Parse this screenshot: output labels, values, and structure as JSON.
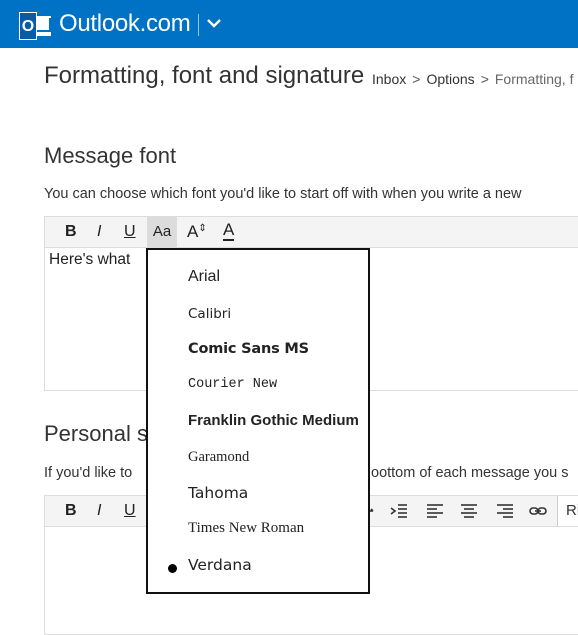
{
  "header": {
    "logo_letter": "O",
    "brand": "Outlook.com",
    "colors": {
      "bar": "#0072c6"
    }
  },
  "page": {
    "title": "Formatting, font and signature",
    "breadcrumb": [
      "Inbox",
      "Options",
      "Formatting, f"
    ]
  },
  "message_font": {
    "heading": "Message font",
    "description": "You can choose which font you'd like to start off with when you write a new",
    "toolbar": {
      "bold": "B",
      "italic": "I",
      "underline": "U",
      "font": "Aa",
      "size": "A",
      "size_arrows": "⇕",
      "color": "A"
    },
    "preview_text": "Here's what"
  },
  "font_menu": {
    "items": [
      {
        "label": "Arial",
        "selected": false
      },
      {
        "label": "Calibri",
        "selected": false
      },
      {
        "label": "Comic Sans MS",
        "selected": false
      },
      {
        "label": "Courier New",
        "selected": false
      },
      {
        "label": "Franklin Gothic Medium",
        "selected": false
      },
      {
        "label": "Garamond",
        "selected": false
      },
      {
        "label": "Tahoma",
        "selected": false
      },
      {
        "label": "Times New Roman",
        "selected": false
      },
      {
        "label": "Verdana",
        "selected": true
      }
    ]
  },
  "signature": {
    "heading": "Personal s",
    "description_left": "If you'd like to",
    "description_right": "oottom of each message you s",
    "toolbar": {
      "bold": "B",
      "italic": "I",
      "underline": "U",
      "truncated_label": "Ri"
    }
  }
}
